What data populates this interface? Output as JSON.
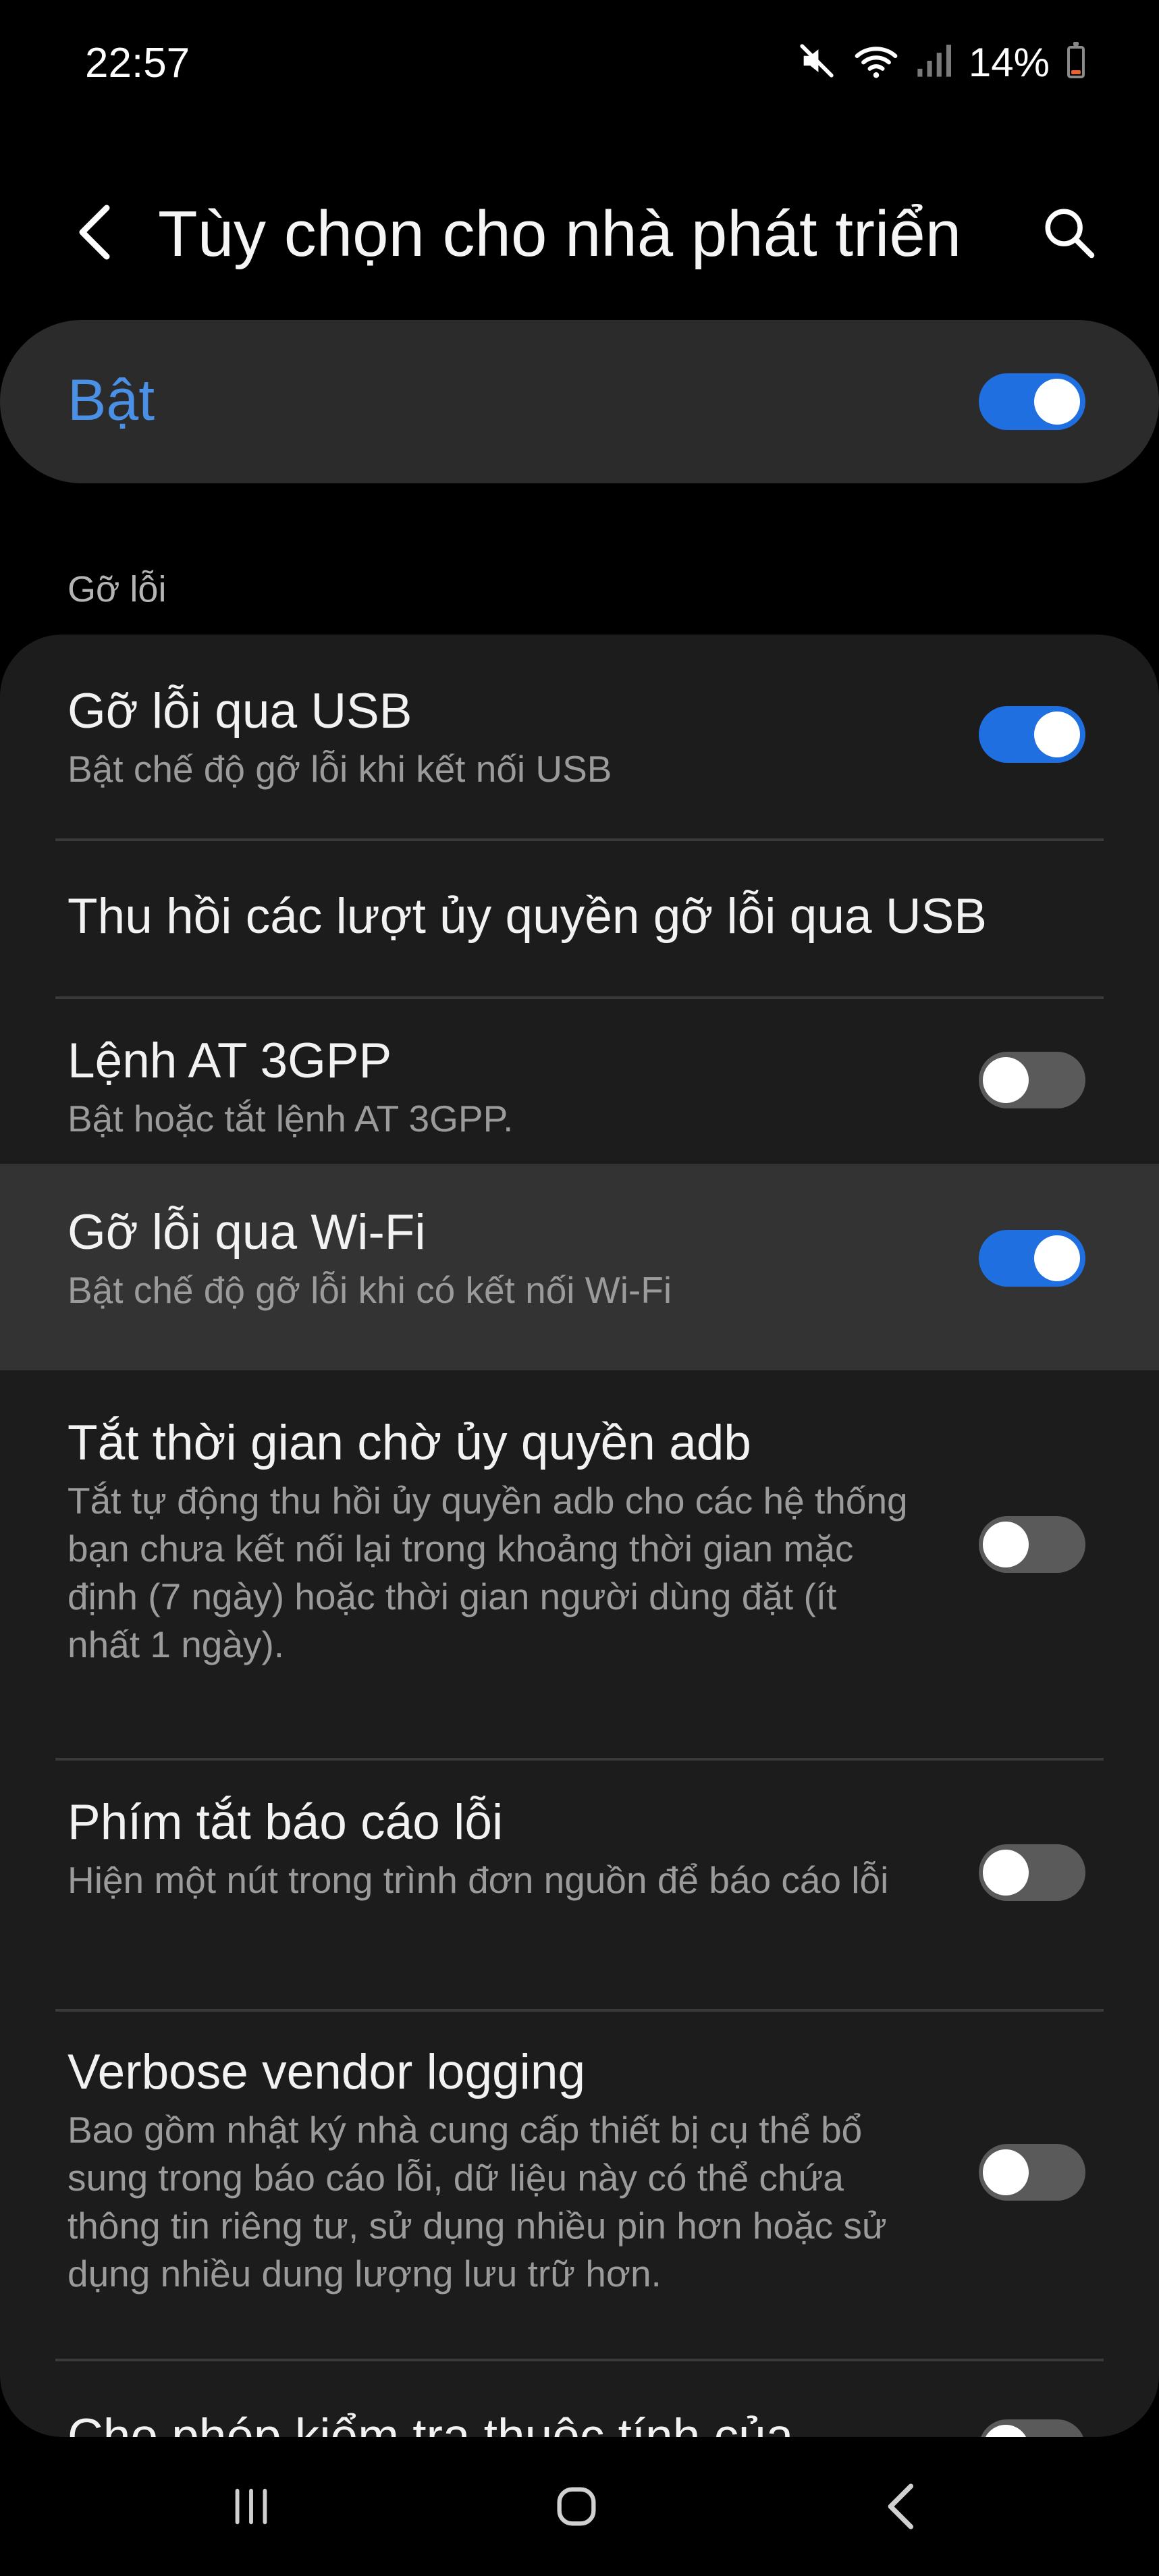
{
  "status_bar": {
    "time": "22:57",
    "battery_percent": "14%",
    "icons": [
      "mute-icon",
      "wifi-icon",
      "signal-icon",
      "battery-icon"
    ],
    "battery_level": 0.14,
    "battery_color": "#e9622f"
  },
  "header": {
    "title": "Tùy chọn cho nhà phát triển",
    "back_icon": "chevron-left-icon",
    "search_icon": "search-icon"
  },
  "master_switch": {
    "label": "Bật",
    "on": true,
    "accent": "#4a90e6"
  },
  "section": {
    "title": "Gỡ lỗi"
  },
  "items": [
    {
      "title": "Gỡ lỗi qua USB",
      "subtitle": "Bật chế độ gỡ lỗi khi kết nối USB",
      "toggle": "on"
    },
    {
      "title": "Thu hồi các lượt ủy quyền gỡ lỗi qua USB"
    },
    {
      "title": "Lệnh AT 3GPP",
      "subtitle": "Bật hoặc tắt lệnh AT 3GPP.",
      "toggle": "off"
    },
    {
      "title": "Gỡ lỗi qua Wi-Fi",
      "subtitle": "Bật chế độ gỡ lỗi khi có kết nối Wi-Fi",
      "toggle": "on",
      "highlighted": true
    },
    {
      "title": "Tắt thời gian chờ ủy quyền adb",
      "subtitle": "Tắt tự động thu hồi ủy quyền adb cho các hệ thống bạn chưa kết nối lại trong khoảng thời gian mặc định (7 ngày) hoặc thời gian người dùng đặt (ít nhất 1 ngày).",
      "toggle": "off"
    },
    {
      "title": "Phím tắt báo cáo lỗi",
      "subtitle": "Hiện một nút trong trình đơn nguồn để báo cáo lỗi",
      "toggle": "off"
    },
    {
      "title": "Verbose vendor logging",
      "subtitle": "Bao gồm nhật ký nhà cung cấp thiết bị cụ thể bổ sung trong báo cáo lỗi, dữ liệu này có thể chứa thông tin riêng tư, sử dụng nhiều pin hơn hoặc sử dụng nhiều dung lượng lưu trữ hơn.",
      "toggle": "off"
    },
    {
      "title": "Cho phép kiểm tra thuộc tính của",
      "toggle": "off",
      "partially_visible": true
    }
  ],
  "nav_bar": {
    "recents_icon": "recents-icon",
    "home_icon": "home-icon",
    "back_icon": "back-icon"
  }
}
